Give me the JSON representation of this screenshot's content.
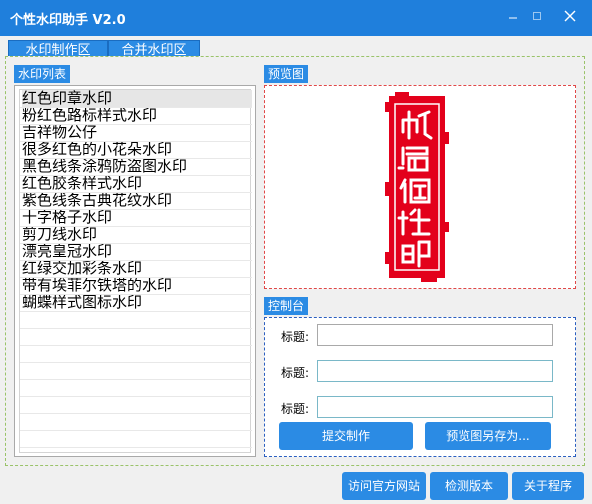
{
  "window": {
    "title": "个性水印助手 V2.0",
    "minimize_icon": "minimize-icon",
    "maximize_icon": "maximize-icon",
    "close_icon": "close-icon"
  },
  "tabs": [
    {
      "label": "水印制作区",
      "active": true
    },
    {
      "label": "合并水印区",
      "active": false
    }
  ],
  "watermark_list": {
    "title": "水印列表",
    "items": [
      "红色印章水印",
      "粉红色路标样式水印",
      "吉祥物公仔",
      "很多红色的小花朵水印",
      "黑色线条涂鸦防盗图水印",
      "红色胶条样式水印",
      "紫色线条古典花纹水印",
      "十字格子水印",
      "剪刀线水印",
      "漂亮皇冠水印",
      "红绿交加彩条水印",
      "带有埃菲尔铁塔的水印",
      "蝴蝶样式图标水印"
    ],
    "selected_index": 0
  },
  "preview": {
    "title": "预览图",
    "seal_color": "#e3001b"
  },
  "control": {
    "title": "控制台",
    "fields": [
      {
        "label": "标题:",
        "value": ""
      },
      {
        "label": "标题:",
        "value": ""
      },
      {
        "label": "标题:",
        "value": ""
      }
    ],
    "submit_label": "提交制作",
    "saveas_label": "预览图另存为..."
  },
  "footer": {
    "visit_label": "访问官方网站",
    "check_label": "检测版本",
    "about_label": "关于程序"
  },
  "colors": {
    "titlebar": "#1f7fdc",
    "accent": "#2b8be4"
  }
}
